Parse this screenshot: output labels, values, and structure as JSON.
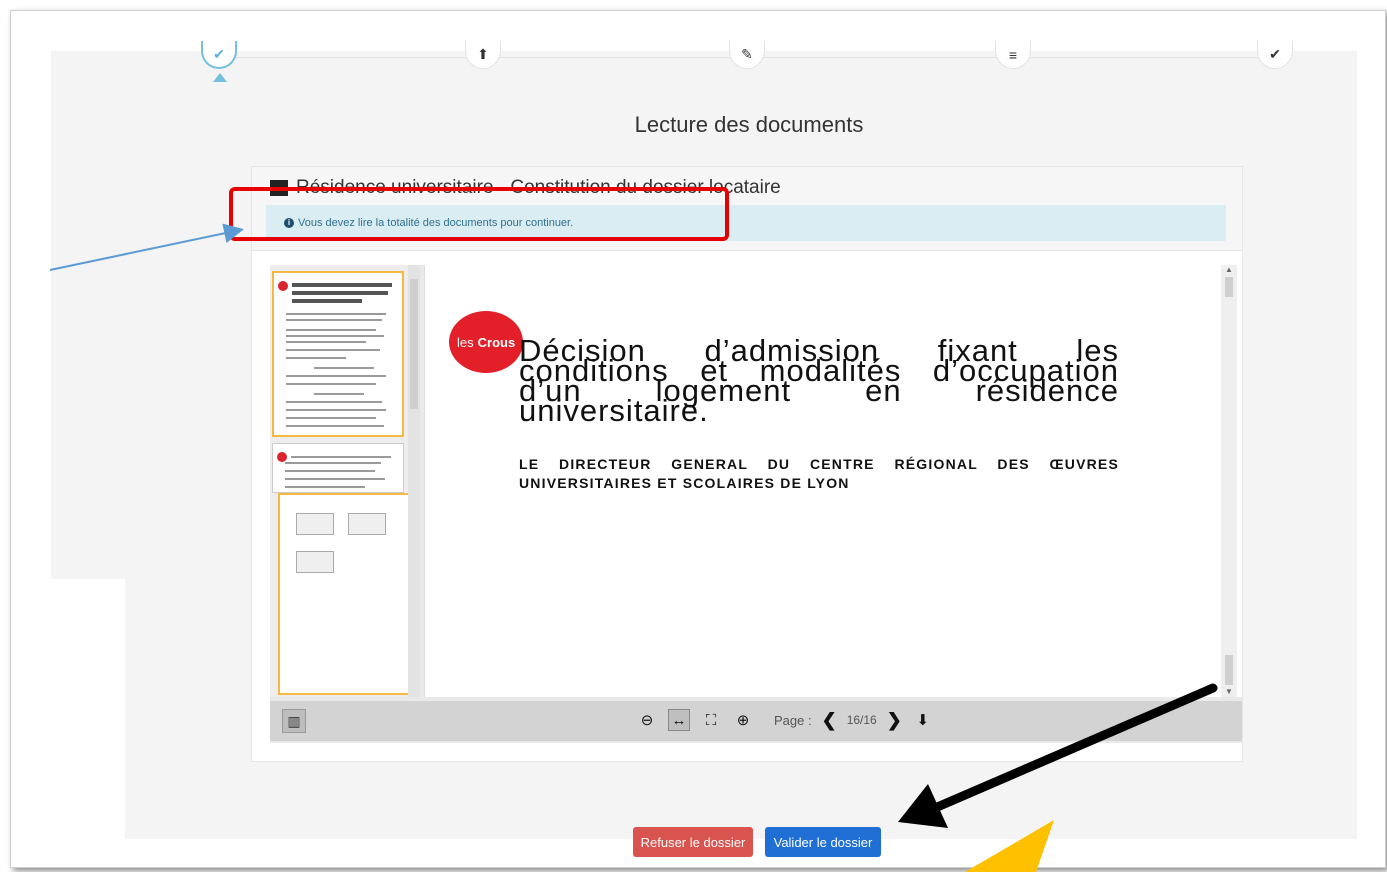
{
  "stepper": {
    "steps": [
      {
        "name": "step-read",
        "icon": "document-check-icon",
        "glyph": "✔",
        "active": true
      },
      {
        "name": "step-upload",
        "icon": "upload-icon",
        "glyph": "⬆",
        "active": false
      },
      {
        "name": "step-edit",
        "icon": "edit-icon",
        "glyph": "✎",
        "active": false
      },
      {
        "name": "step-list",
        "icon": "list-icon",
        "glyph": "≡",
        "active": false
      },
      {
        "name": "step-done",
        "icon": "check-icon",
        "glyph": "✔",
        "active": false
      }
    ]
  },
  "page": {
    "title": "Lecture des documents"
  },
  "panel": {
    "heading": "Résidence universitaire - Constitution du dossier locataire",
    "alert": "Vous devez lire la totalité des documents pour continuer."
  },
  "document": {
    "logo_prefix": "les",
    "logo_brand": "Crous",
    "title": "Décision d’admission fixant les conditions et modalités d’occupation d’un logement en résidence universitaire.",
    "subtitle": "LE DIRECTEUR GENERAL DU CENTRE RÉGIONAL DES ŒUVRES UNIVERSITAIRES ET SCOLAIRES DE LYON"
  },
  "toolbar": {
    "page_label": "Page :",
    "page_value": "16/16"
  },
  "buttons": {
    "refuse": "Refuser le dossier",
    "validate": "Valider le dossier"
  },
  "colors": {
    "accent_blue": "#1f6fd4",
    "danger_red": "#d9534f",
    "alert_bg": "#d9edf3",
    "crous_red": "#e3202a",
    "annotation_red": "#e60000",
    "annotation_yellow": "#ffc000"
  }
}
